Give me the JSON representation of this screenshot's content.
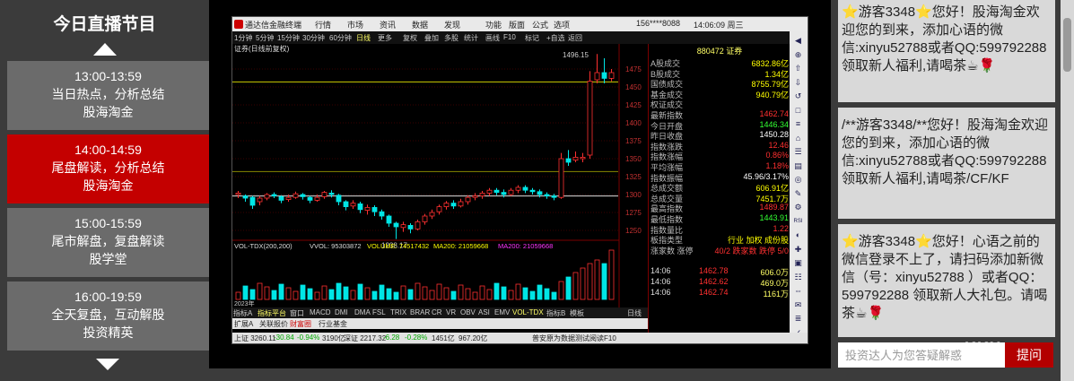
{
  "schedule": {
    "title": "今日直播节目",
    "programs": [
      {
        "time": "13:00-13:59",
        "desc": "当日热点，分析总结",
        "host": "股海淘金",
        "active": false
      },
      {
        "time": "14:00-14:59",
        "desc": "尾盘解读，分析总结",
        "host": "股海淘金",
        "active": true
      },
      {
        "time": "15:00-15:59",
        "desc": "尾市解盘，复盘解读",
        "host": "股学堂",
        "active": false
      },
      {
        "time": "16:00-19:59",
        "desc": "全天复盘，互动解股",
        "host": "投资精英",
        "active": false
      }
    ]
  },
  "terminal": {
    "menu": [
      "通达信金融终端",
      "行情",
      "市场",
      "资讯",
      "数据",
      "发现",
      "功能",
      "版面",
      "公式",
      "选项",
      "156****8088",
      "14:06:09 周三"
    ],
    "toolbar": [
      "1分钟",
      "5分钟",
      "15分钟",
      "30分钟",
      "60分钟",
      "日线",
      "更多",
      "复权",
      "叠加",
      "多股",
      "统计",
      "画线",
      "F10",
      "标记",
      "+自选",
      "返回"
    ],
    "quote_code": "880472 证券",
    "chart_title": "证券(日线前复权)",
    "price_labels": [
      "1475",
      "1450",
      "1425",
      "1400",
      "1375",
      "1350",
      "1325",
      "1300",
      "1275",
      "1250"
    ],
    "high_label": "1496.15",
    "low_label": "1238.17",
    "vol_header": [
      "VOL-TDX(200,200)",
      "VVOL: 95303872",
      "VOLUME: 74517432",
      "MA200: 21059668",
      "MA200: 21059668"
    ],
    "year_label": "2023年",
    "quote_rows": [
      {
        "k": "A股成交",
        "v": "6832.86亿",
        "c": "#ffff00"
      },
      {
        "k": "B股成交",
        "v": "1.34亿",
        "c": "#ffff00"
      },
      {
        "k": "国债成交",
        "v": "8755.79亿",
        "c": "#ffff00"
      },
      {
        "k": "基金成交",
        "v": "940.79亿",
        "c": "#ffff00"
      },
      {
        "k": "权证成交",
        "v": "",
        "c": "#ffff00"
      },
      {
        "k": "最新指数",
        "v": "1462.74",
        "c": "#ff3030"
      },
      {
        "k": "今日开盘",
        "v": "1446.34",
        "c": "#33ff33"
      },
      {
        "k": "昨日收盘",
        "v": "1450.28",
        "c": "#ffffff"
      },
      {
        "k": "指数涨跌",
        "v": "12.46",
        "c": "#ff3030"
      },
      {
        "k": "指数涨幅",
        "v": "0.86%",
        "c": "#ff3030"
      },
      {
        "k": "平均涨幅",
        "v": "1.18%",
        "c": "#ff3030"
      },
      {
        "k": "指数振幅",
        "v": "45.96/3.17%",
        "c": "#ffffff"
      },
      {
        "k": "总成交额",
        "v": "606.91亿",
        "c": "#ffff00"
      },
      {
        "k": "总成交量",
        "v": "7451.7万",
        "c": "#ffff00"
      },
      {
        "k": "最高指数",
        "v": "1489.87",
        "c": "#ff3030"
      },
      {
        "k": "最低指数",
        "v": "1443.91",
        "c": "#33ff33"
      },
      {
        "k": "指数量比",
        "v": "1.22",
        "c": "#ff3030"
      },
      {
        "k": "板指类型",
        "v": "行业 加权 成份股",
        "c": "#ffff00"
      },
      {
        "k": "涨家数 涨停",
        "v": "40/2 跌家数 跌停 5/0",
        "c": "#ff3030"
      }
    ],
    "ticks": [
      {
        "t": "14:06",
        "p": "1462.78",
        "v": "606.0万"
      },
      {
        "t": "14:06",
        "p": "1462.62",
        "v": "469.0万"
      },
      {
        "t": "14:06",
        "p": "1462.74",
        "v": "1161万"
      }
    ],
    "tabs": [
      "指标A",
      "指标平台",
      "窗口",
      "MACD",
      "DMI",
      "DMA",
      "FSL",
      "TRIX",
      "BRAR",
      "CR",
      "VR",
      "OBV",
      "ASI",
      "EMV",
      "VOL-TDX",
      "指标B",
      "模板",
      "日线"
    ],
    "tabs2": [
      "扩展A",
      "关联报价",
      "财富圈",
      "行业基金"
    ],
    "status": [
      "上证 3260.11",
      "-30.84",
      "-0.94%",
      "3190亿",
      "深证 2217.32",
      "-6.28",
      "-0.28%",
      "1451亿",
      "967.20亿",
      "普安原为数据测试",
      "阅读F10"
    ],
    "rightbar_icons": [
      "◀",
      "⊕",
      "⇧",
      "⇩",
      "↺",
      "□",
      "≡",
      "⌂",
      "☰",
      "▤",
      "◎",
      "✎",
      "⚙",
      "RSI",
      "◐",
      "✚",
      "▣",
      "☷",
      "⇔",
      "✉",
      "≣",
      "✓"
    ]
  },
  "chat": {
    "messages": [
      "⭐游客3348⭐您好！股海淘金欢迎您的到来，添加心语的微信:xinyu52788或者QQ:599792288领取新人福利,请喝茶☕🌹",
      "/**游客3348/**您好！股海淘金欢迎您的到来，添加心语的微信:xinyu52788或者QQ:599792288领取新人福利,请喝茶/CF/KF",
      "⭐游客3348⭐您好！心语之前的微信登录不上了，请扫码添加新微信（号：xinyu52788 ）或者QQ：599792288 领取新人大礼包。请喝茶☕🌹"
    ],
    "input_placeholder": "投资达人为您答疑解惑",
    "send_label": "提问"
  },
  "watermark": "KKX",
  "colors": {
    "active": "#c40000",
    "button": "#b30000",
    "up": "#ff3030",
    "down": "#00e5e5"
  }
}
